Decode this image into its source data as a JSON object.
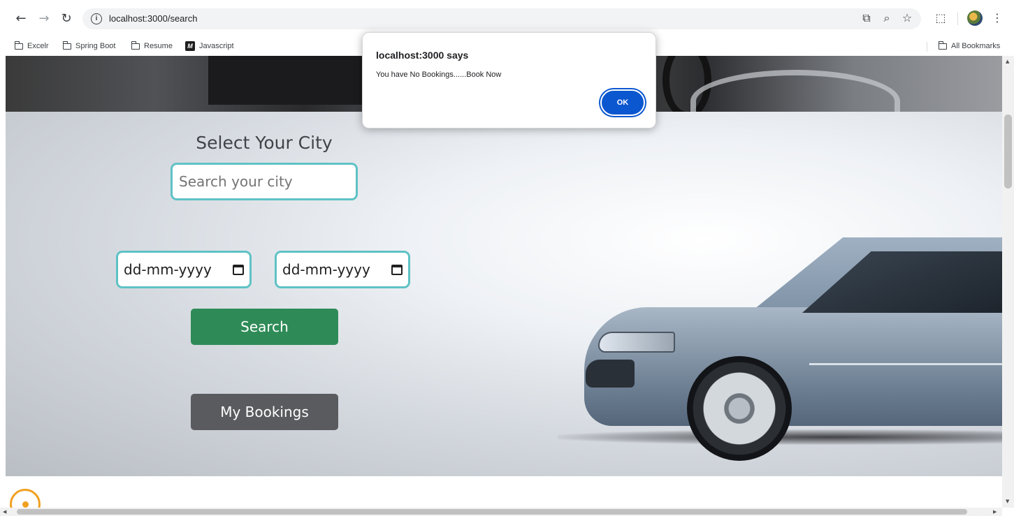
{
  "browser": {
    "url": "localhost:3000/search",
    "bookmarks": [
      {
        "label": "Excelr",
        "icon": "folder-icon"
      },
      {
        "label": "Spring Boot",
        "icon": "folder-icon"
      },
      {
        "label": "Resume",
        "icon": "folder-icon"
      },
      {
        "label": "Javascript",
        "icon": "m-logo-icon"
      }
    ],
    "all_bookmarks_label": "All Bookmarks",
    "m_logo_letter": "M"
  },
  "page": {
    "title": "Select Your City",
    "city_placeholder": "Search your city",
    "date_from": "dd-mm-yyyy",
    "date_to": "dd-mm-yyyy",
    "search_label": "Search",
    "bookings_label": "My Bookings"
  },
  "dialog": {
    "title": "localhost:3000 says",
    "message": "You have No Bookings......Book Now",
    "ok_label": "OK"
  },
  "colors": {
    "accent_border": "#5fc2c5",
    "search_button": "#2e8b57",
    "bookings_button": "#5a5b5e",
    "dialog_ok": "#0b57d0"
  }
}
